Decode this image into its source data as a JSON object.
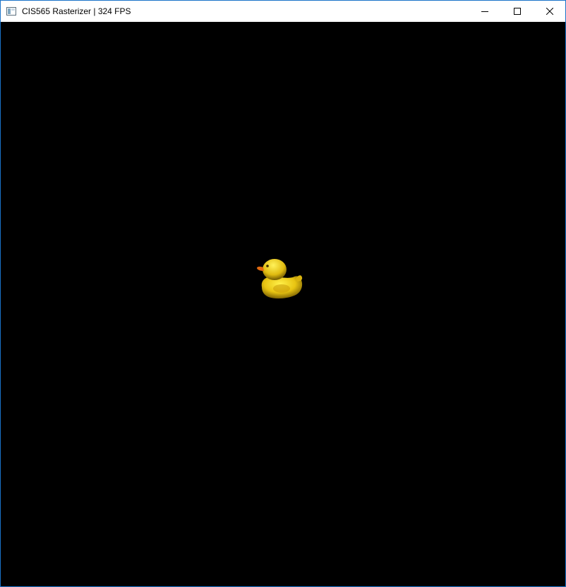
{
  "window": {
    "title": "CIS565 Rasterizer | 324 FPS",
    "icon": "app-window-icon",
    "buttons": {
      "minimize": "minimize-icon",
      "maximize": "maximize-icon",
      "close": "close-icon"
    }
  },
  "scene": {
    "background": "#000000",
    "model": "rubber-duck",
    "duck_color": "#f2d21a",
    "beak_color": "#e06a10"
  }
}
